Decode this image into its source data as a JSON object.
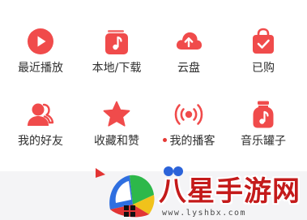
{
  "colors": {
    "accent": "#F04B4B",
    "accent_dark": "#E23434",
    "label_text": "#2F2F2F",
    "dot": "#E53935",
    "background": "#F4F4F6",
    "card": "#FFFFFF",
    "watermark_text": "#C41A1A"
  },
  "quick_menu": {
    "items": [
      {
        "label": "最近播放",
        "icon": "play-circle-icon"
      },
      {
        "label": "本地/下载",
        "icon": "music-file-icon"
      },
      {
        "label": "云盘",
        "icon": "cloud-upload-icon"
      },
      {
        "label": "已购",
        "icon": "shopping-bag-check-icon"
      },
      {
        "label": "我的好友",
        "icon": "friends-icon"
      },
      {
        "label": "收藏和赞",
        "icon": "star-icon"
      },
      {
        "label": "我的播客",
        "icon": "broadcast-icon",
        "has_dot": true
      },
      {
        "label": "音乐罐子",
        "icon": "music-jar-icon"
      }
    ]
  },
  "watermark": {
    "brand": "八星手游网",
    "url": "www.lyshbx.com"
  }
}
